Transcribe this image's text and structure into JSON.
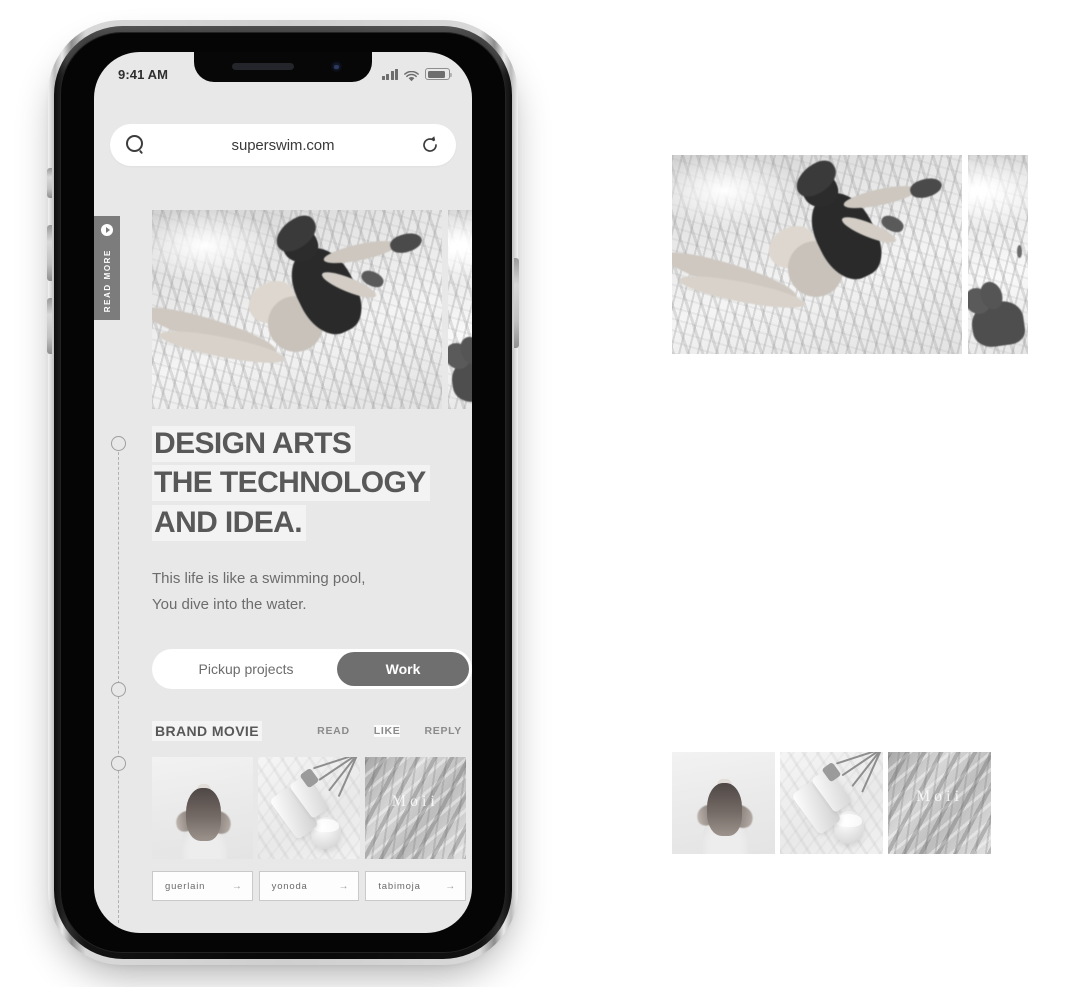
{
  "device": {
    "label": "iphone-x-mockup"
  },
  "status_bar": {
    "time": "9:41 AM",
    "icons": [
      "signal-icon",
      "wifi-icon",
      "battery-icon"
    ]
  },
  "browser": {
    "url": "superswim.com",
    "search_icon": "search-icon",
    "reload_icon": "reload-icon"
  },
  "side_tab": {
    "label": "READ MORE",
    "icon": "play-circle-icon"
  },
  "hero": {
    "main_alt": "underwater-swimmer-photo",
    "side_alt": "underwater-hand-photo"
  },
  "headline": {
    "line1": "DESIGN ARTS",
    "line2": "THE TECHNOLOGY",
    "line3": "AND IDEA."
  },
  "subcopy": {
    "line1": "This life is like a swimming pool,",
    "line2": "You dive into the water."
  },
  "toggle": {
    "inactive_label": "Pickup projects",
    "active_label": "Work"
  },
  "brand_movie": {
    "title": "BRAND MOVIE",
    "links": [
      {
        "label": "READ",
        "highlighted": false
      },
      {
        "label": "LIKE",
        "highlighted": true
      },
      {
        "label": "REPLY",
        "highlighted": false
      }
    ]
  },
  "thumbnails": [
    {
      "alt": "girl-from-behind-photo",
      "overlay": ""
    },
    {
      "alt": "cosmetic-bottles-photo",
      "overlay": ""
    },
    {
      "alt": "marble-texture-photo",
      "overlay": "Moii"
    }
  ],
  "chips": [
    {
      "label": "guerlain",
      "arrow": "→"
    },
    {
      "label": "yonoda",
      "arrow": "→"
    },
    {
      "label": "tabimoja",
      "arrow": "→"
    }
  ],
  "detached_assets": [
    {
      "name": "hero-main-asset"
    },
    {
      "name": "hero-side-asset"
    },
    {
      "name": "thumb-1-asset"
    },
    {
      "name": "thumb-2-asset"
    },
    {
      "name": "thumb-3-asset"
    }
  ],
  "colors": {
    "app_background": "#e8e8e8",
    "page_background": "#ffffff",
    "text_primary": "#585858",
    "text_secondary": "#6c6c6c",
    "accent_dark": "#6f6f6f",
    "tab_background": "#7c7c7c",
    "chip_border": "#c9c9c9"
  }
}
